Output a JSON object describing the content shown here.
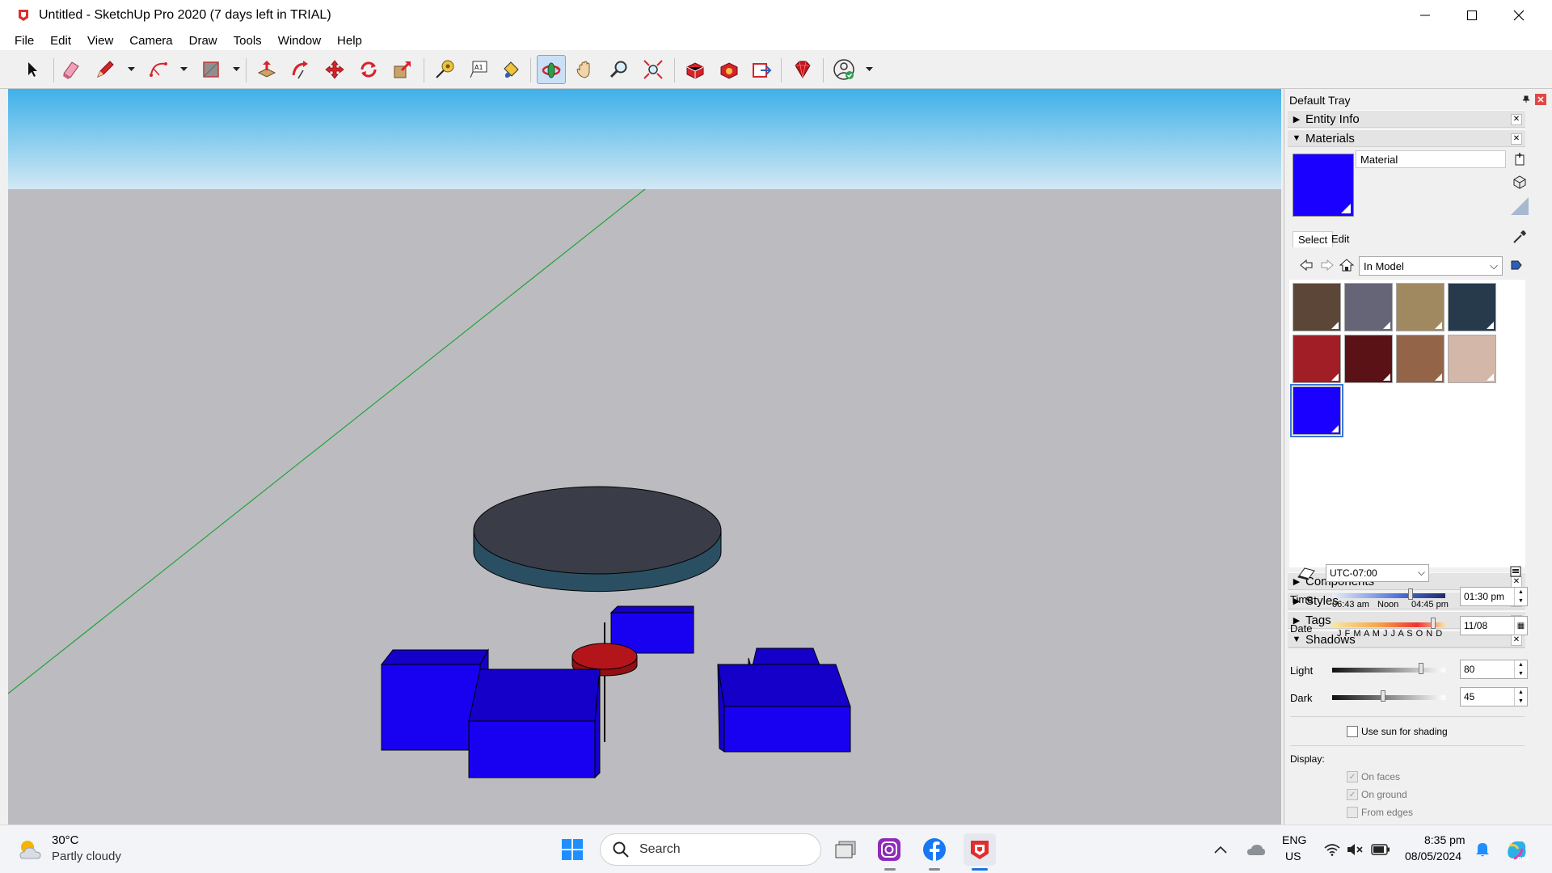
{
  "window": {
    "title": "Untitled - SketchUp Pro 2020 (7 days left in TRIAL)"
  },
  "menu": [
    "File",
    "Edit",
    "View",
    "Camera",
    "Draw",
    "Tools",
    "Window",
    "Help"
  ],
  "tray": {
    "title": "Default Tray",
    "panels": {
      "entity_info": "Entity Info",
      "materials": "Materials",
      "components": "Components",
      "styles": "Styles",
      "tags": "Tags",
      "shadows": "Shadows"
    },
    "materials": {
      "current_name": "Material",
      "current_color": "#1a00ff",
      "tab_select": "Select",
      "tab_edit": "Edit",
      "collection": "In Model",
      "swatches": [
        "#5b4638",
        "#656577",
        "#a08961",
        "#263a4b",
        "#a11e26",
        "#5a1216",
        "#946449",
        "#d3b7a9",
        "#1a00ff"
      ]
    },
    "shadows": {
      "timezone": "UTC-07:00",
      "time_label": "Time",
      "time_ticks": {
        "start": "06:43 am",
        "mid": "Noon",
        "end": "04:45 pm"
      },
      "time_value": "01:30 pm",
      "date_label": "Date",
      "months": "J F M A M J J A S O N D",
      "date_value": "11/08",
      "light_label": "Light",
      "light_value": "80",
      "light_level": 0.8,
      "dark_label": "Dark",
      "dark_value": "45",
      "dark_level": 0.45,
      "use_sun": "Use sun for shading",
      "display_label": "Display:",
      "on_faces": "On faces",
      "on_ground": "On ground",
      "from_edges": "From edges"
    }
  },
  "colors": {
    "sky_top": "#3eb1e9",
    "sky_bottom": "#d2e8f4",
    "ground": "#bcbcc0",
    "blue_box": "#1800f0",
    "table_top": "#3a3d47",
    "table_edge": "#2b4f62",
    "base": "#b4151b",
    "green_axis": "#22a33a"
  },
  "taskbar": {
    "weather_temp": "30°C",
    "weather_desc": "Partly cloudy",
    "search": "Search",
    "lang": "ENG",
    "region": "US",
    "time": "8:35 pm",
    "date": "08/05/2024"
  }
}
